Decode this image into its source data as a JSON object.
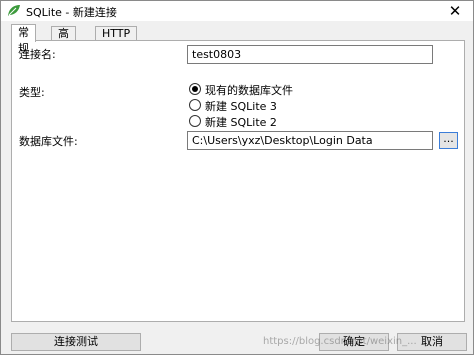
{
  "window": {
    "title": "SQLite - 新建连接",
    "close_glyph": "✕",
    "app_icon": "green-leaf-icon"
  },
  "tabs": [
    {
      "label": "常规",
      "active": true
    },
    {
      "label": "高级",
      "active": false
    },
    {
      "label": "HTTP",
      "active": false
    }
  ],
  "form": {
    "connection_name_label": "连接名:",
    "connection_name_value": "test0803",
    "type_label": "类型:",
    "type_options": [
      {
        "label": "现有的数据库文件",
        "selected": true
      },
      {
        "label": "新建 SQLite 3",
        "selected": false
      },
      {
        "label": "新建 SQLite 2",
        "selected": false
      }
    ],
    "db_file_label": "数据库文件:",
    "db_file_value": "C:\\Users\\yxz\\Desktop\\Login Data",
    "browse_label": "..."
  },
  "buttons": {
    "test_connection": "连接测试",
    "ok": "确定",
    "cancel": "取消"
  },
  "watermark": "https://blog.csdn.net/weixin_..."
}
